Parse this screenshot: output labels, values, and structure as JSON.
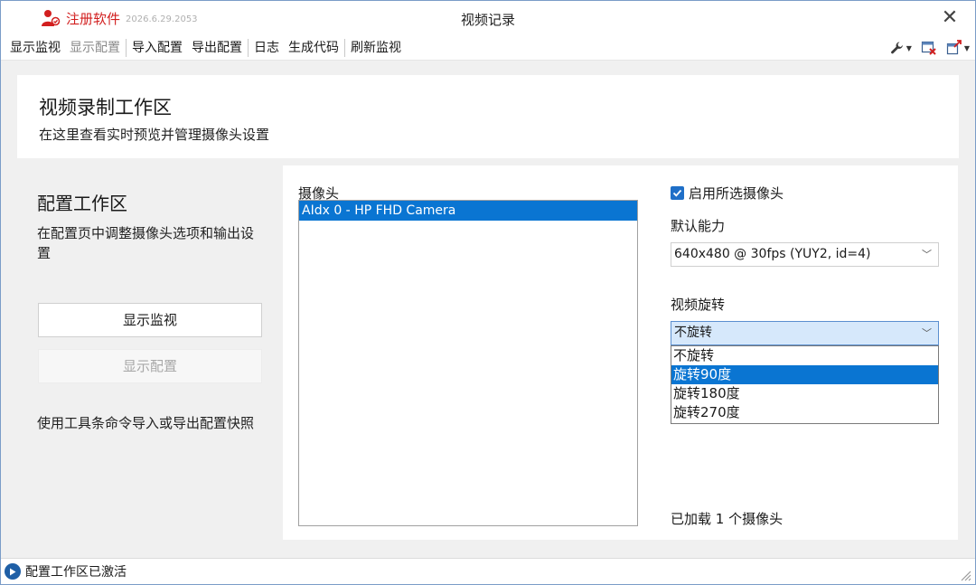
{
  "titlebar": {
    "register_label": "注册软件",
    "version": "2026.6.29.2053",
    "title": "视频记录",
    "close_glyph": "✕"
  },
  "menubar": {
    "items": [
      {
        "label": "显示监视",
        "enabled": true
      },
      {
        "label": "显示配置",
        "enabled": false
      },
      {
        "label": "导入配置",
        "enabled": true
      },
      {
        "label": "导出配置",
        "enabled": true
      },
      {
        "label": "日志",
        "enabled": true
      },
      {
        "label": "生成代码",
        "enabled": true
      },
      {
        "label": "刷新监视",
        "enabled": true
      }
    ],
    "right_icons": [
      "wrench-icon",
      "close-window-icon",
      "export-icon"
    ]
  },
  "header": {
    "title": "视频录制工作区",
    "subtitle": "在这里查看实时预览并管理摄像头设置"
  },
  "left_panel": {
    "title": "配置工作区",
    "description": "在配置页中调整摄像头选项和输出设置",
    "show_monitor_button": "显示监视",
    "show_config_button": "显示配置",
    "note": "使用工具条命令导入或导出配置快照"
  },
  "camera_panel": {
    "label": "摄像头",
    "cameras": [
      {
        "name": "AIdx 0 - HP FHD Camera",
        "selected": true
      }
    ]
  },
  "settings": {
    "enable_checkbox_label": "启用所选摄像头",
    "enable_checked": true,
    "capability_label": "默认能力",
    "capability_value": "640x480 @ 30fps (YUY2, id=4)",
    "rotation_label": "视频旋转",
    "rotation_value": "不旋转",
    "rotation_options": [
      {
        "label": "不旋转",
        "highlighted": false
      },
      {
        "label": "旋转90度",
        "highlighted": true
      },
      {
        "label": "旋转180度",
        "highlighted": false
      },
      {
        "label": "旋转270度",
        "highlighted": false
      }
    ],
    "loaded_text": "已加载 1 个摄像头"
  },
  "statusbar": {
    "text": "配置工作区已激活"
  },
  "colors": {
    "accent": "#0a75d2",
    "register_red": "#d21f1f",
    "window_border": "#7a9cc8"
  }
}
